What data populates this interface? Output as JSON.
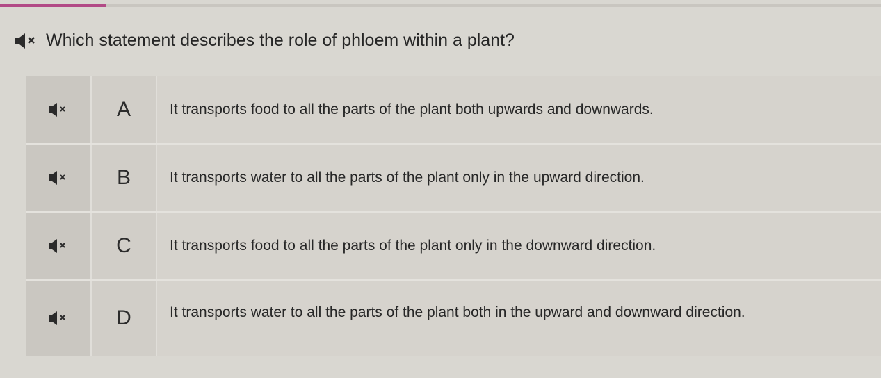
{
  "progress": {
    "fraction": 0.12,
    "color": "#b24a86"
  },
  "question": {
    "text": "Which statement describes the role of phloem within a plant?",
    "audio_icon": "speaker-icon"
  },
  "options": [
    {
      "letter": "A",
      "text": "It transports food to all the parts of the plant both upwards and downwards."
    },
    {
      "letter": "B",
      "text": "It transports water to all the parts of the plant only in the upward direction."
    },
    {
      "letter": "C",
      "text": "It transports food to all the parts of the plant only in the downward direction."
    },
    {
      "letter": "D",
      "text": "It transports water to all the parts of the plant both in the upward and downward direction."
    }
  ]
}
